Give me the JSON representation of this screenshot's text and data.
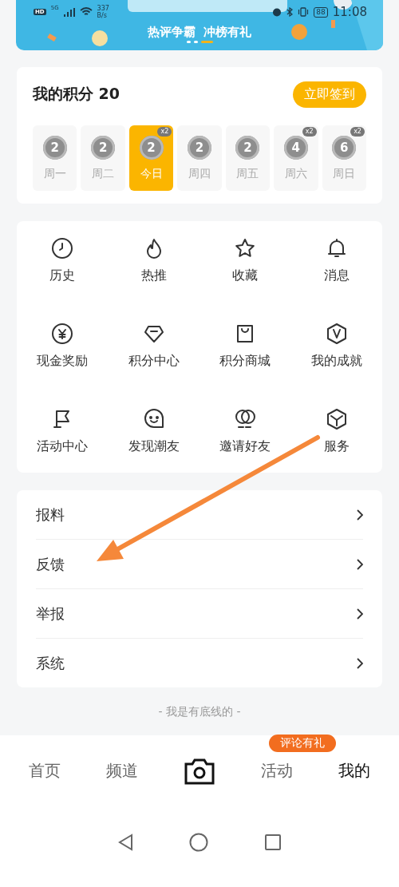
{
  "status_bar": {
    "hd": "HD",
    "network": "5G",
    "speed_value": "337",
    "speed_unit": "B/s",
    "battery": "88",
    "time": "11:08"
  },
  "banner": {
    "kind": "picture",
    "caption": "热评争霸  冲榜有礼",
    "dots": [
      {
        "selected": false
      },
      {
        "selected": false
      },
      {
        "selected": true
      }
    ]
  },
  "points": {
    "title": "我的积分",
    "value": "20",
    "sign_button": "立即签到",
    "days": [
      {
        "label": "周一",
        "coin": "2",
        "selected": false
      },
      {
        "label": "周二",
        "coin": "2",
        "selected": false
      },
      {
        "label": "今日",
        "coin": "2",
        "selected": true,
        "badge": "x2"
      },
      {
        "label": "周四",
        "coin": "2",
        "selected": false
      },
      {
        "label": "周五",
        "coin": "2",
        "selected": false
      },
      {
        "label": "周六",
        "coin": "4",
        "selected": false,
        "badge": "x2"
      },
      {
        "label": "周日",
        "coin": "6",
        "selected": false,
        "badge": "x2"
      }
    ]
  },
  "grid": [
    {
      "label": "历史"
    },
    {
      "label": "热推"
    },
    {
      "label": "收藏"
    },
    {
      "label": "消息"
    },
    {
      "label": "现金奖励"
    },
    {
      "label": "积分中心"
    },
    {
      "label": "积分商城"
    },
    {
      "label": "我的成就"
    },
    {
      "label": "活动中心"
    },
    {
      "label": "发现潮友"
    },
    {
      "label": "邀请好友"
    },
    {
      "label": "服务"
    }
  ],
  "list": [
    {
      "label": "报料"
    },
    {
      "label": "反馈"
    },
    {
      "label": "举报"
    },
    {
      "label": "系统"
    }
  ],
  "footer": "- 我是有底线的 -",
  "tab_bar": [
    {
      "kind": "label",
      "label": "首页",
      "selected": false
    },
    {
      "kind": "label",
      "label": "频道",
      "selected": false
    },
    {
      "kind": "camera",
      "selected": false
    },
    {
      "kind": "label",
      "label": "活动",
      "selected": false,
      "badge": "评论有礼"
    },
    {
      "kind": "label",
      "label": "我的",
      "selected": true
    }
  ]
}
